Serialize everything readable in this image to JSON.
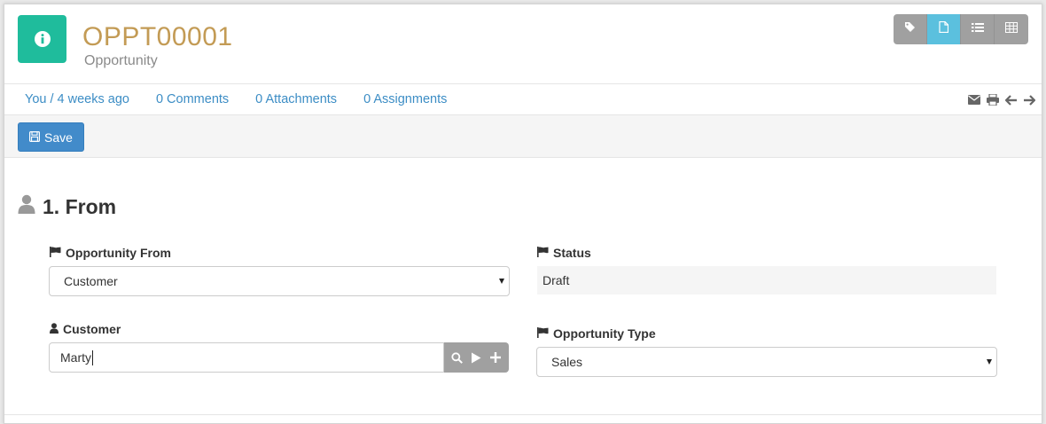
{
  "header": {
    "title": "OPPT00001",
    "subtitle": "Opportunity",
    "info_icon": "info-icon",
    "view_buttons": [
      {
        "name": "tag-icon",
        "active": false
      },
      {
        "name": "document-icon",
        "active": true
      },
      {
        "name": "list-icon",
        "active": false
      },
      {
        "name": "grid-icon",
        "active": false
      }
    ]
  },
  "meta": {
    "owner": "You / 4 weeks ago",
    "comments": "0 Comments",
    "attachments": "0 Attachments",
    "assignments": "0 Assignments",
    "icons": [
      "envelope-icon",
      "print-icon",
      "arrow-left-icon",
      "arrow-right-icon"
    ]
  },
  "toolbar": {
    "save_label": "Save"
  },
  "section": {
    "title": "1. From",
    "fields": {
      "opportunity_from": {
        "label": "Opportunity From",
        "value": "Customer"
      },
      "status": {
        "label": "Status",
        "value": "Draft"
      },
      "customer": {
        "label": "Customer",
        "value": "Marty"
      },
      "opportunity_type": {
        "label": "Opportunity Type",
        "value": "Sales"
      }
    }
  },
  "colors": {
    "accent_teal": "#1fbc9c",
    "title_gold": "#c39b55",
    "link_blue": "#3c8dc5",
    "primary_button": "#428bca",
    "active_view": "#5bc0de"
  }
}
